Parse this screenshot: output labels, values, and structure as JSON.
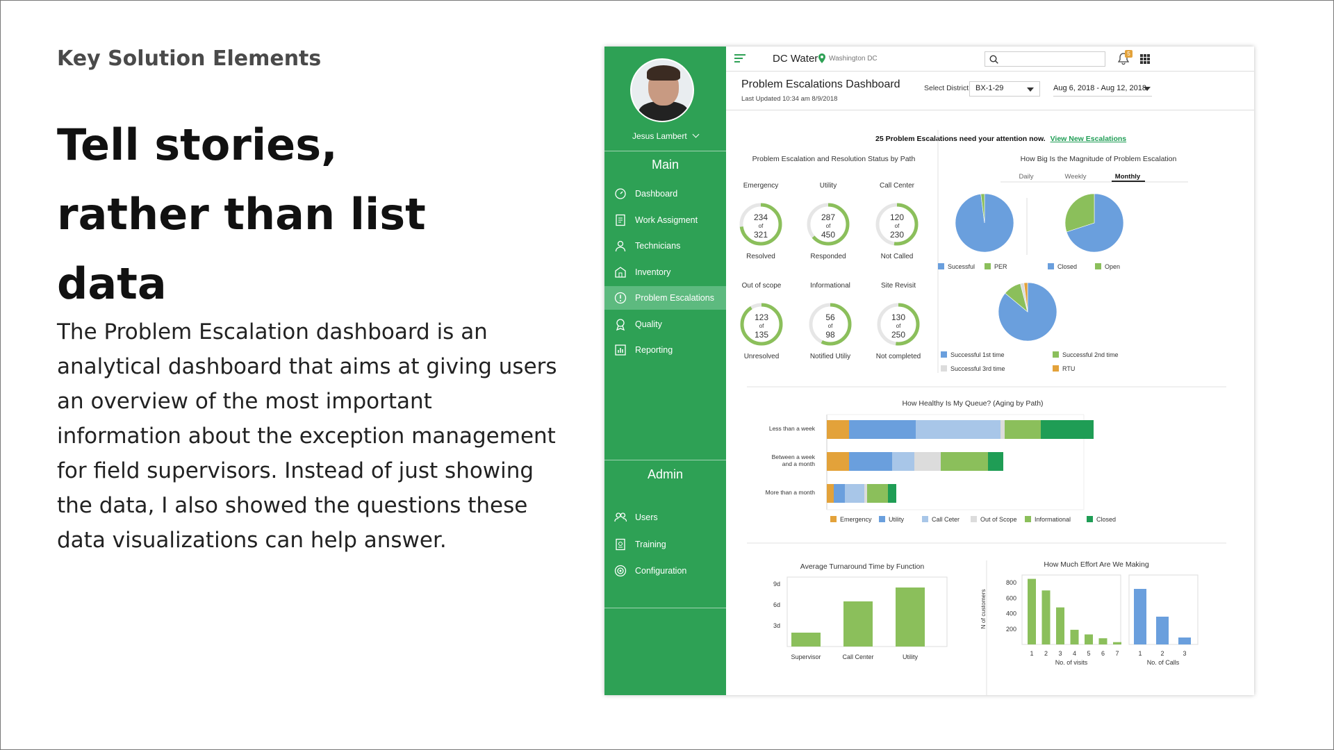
{
  "slide": {
    "kicker": "Key Solution Elements",
    "headline": "Tell stories, rather than list data",
    "body": "The Problem Escalation dashboard is an analytical dashboard that aims at giving users an overview of the most important information about the exception management for field supervisors. Instead of just showing the data, I also showed the questions these data visualizations can help answer."
  },
  "sidebar": {
    "user_name": "Jesus Lambert",
    "main_title": "Main",
    "admin_title": "Admin",
    "main_items": [
      {
        "label": "Dashboard",
        "icon": "dashboard-icon"
      },
      {
        "label": "Work Assigment",
        "icon": "document-icon"
      },
      {
        "label": "Technicians",
        "icon": "technician-icon"
      },
      {
        "label": "Inventory",
        "icon": "building-icon"
      },
      {
        "label": "Problem Escalations",
        "icon": "alert-circle-icon",
        "active": true
      },
      {
        "label": "Quality",
        "icon": "badge-icon"
      },
      {
        "label": "Reporting",
        "icon": "report-icon"
      }
    ],
    "admin_items": [
      {
        "label": "Users",
        "icon": "users-icon"
      },
      {
        "label": "Training",
        "icon": "training-icon"
      },
      {
        "label": "Configuration",
        "icon": "gear-icon"
      }
    ],
    "colors": {
      "bg": "#2ea155",
      "active": "#5dba7f"
    }
  },
  "topbar": {
    "app_name": "DC Water",
    "location": "Washington DC",
    "search_placeholder": "",
    "notification_count": "5"
  },
  "header": {
    "title": "Problem Escalations Dashboard",
    "updated": "Last Updated 10:34 am 8/9/2018",
    "district_label": "Select District",
    "district_value": "BX-1-29",
    "date_range": "Aug 6, 2018 - Aug 12, 2018"
  },
  "alert": {
    "text": "25 Problem Escalations need your attention now.",
    "link": "View New Escalations"
  },
  "status": {
    "title": "Problem Escalation and Resolution Status by Path",
    "of_word": "of",
    "rings": [
      {
        "top": "Emergency",
        "value": "234",
        "total": "321",
        "bottom": "Resolved",
        "fraction": 0.729
      },
      {
        "top": "Utility",
        "value": "287",
        "total": "450",
        "bottom": "Responded",
        "fraction": 0.638
      },
      {
        "top": "Call Center",
        "value": "120",
        "total": "230",
        "bottom": "Not Called",
        "fraction": 0.522
      },
      {
        "top": "Out of scope",
        "value": "123",
        "total": "135",
        "bottom": "Unresolved",
        "fraction": 0.911
      },
      {
        "top": "Informational",
        "value": "56",
        "total": "98",
        "bottom": "Notified Utiliy",
        "fraction": 0.571
      },
      {
        "top": "Site Revisit",
        "value": "130",
        "total": "250",
        "bottom": "Not completed",
        "fraction": 0.52
      }
    ]
  },
  "magnitude": {
    "title": "How Big Is the Magnitude of Problem Escalation",
    "tabs": [
      "Daily",
      "Weekly",
      "Monthly"
    ],
    "active_tab": "Monthly",
    "legend1": [
      "Sucessful",
      "PER"
    ],
    "legend2": [
      "Closed",
      "Open"
    ],
    "legend3": [
      "Successful 1st time",
      "Successful 2nd time",
      "Successful 3rd time",
      "RTU"
    ]
  },
  "queue": {
    "title": "How Healthy Is My Queue? (Aging by Path)",
    "legend": [
      "Emergency",
      "Utility",
      "Call Ceter",
      "Out of Scope",
      "Informational",
      "Closed"
    ]
  },
  "turnaround": {
    "title": "Average Turnaround Time by Function",
    "y_ticks": [
      "9d",
      "6d",
      "3d"
    ]
  },
  "effort": {
    "title": "How Much Effort Are We Making",
    "ylabel": "N of customers",
    "y_ticks": [
      "800",
      "600",
      "400",
      "200"
    ],
    "xlabel1": "No. of visits",
    "xlabel2": "No. of Calls"
  },
  "colors": {
    "green": "#8bbf5b",
    "blue": "#6a9fdd",
    "lightblue": "#a8c6e8",
    "orange": "#e3a23a",
    "gray": "#dcdcdc",
    "darkgreen": "#1f9d55"
  },
  "chart_data": [
    {
      "type": "pie",
      "name": "pie-success-per",
      "categories": [
        "Sucessful",
        "PER"
      ],
      "values": [
        98,
        2
      ],
      "colors": [
        "#6a9fdd",
        "#8bbf5b"
      ]
    },
    {
      "type": "pie",
      "name": "pie-closed-open",
      "categories": [
        "Closed",
        "Open"
      ],
      "values": [
        70,
        30
      ],
      "colors": [
        "#6a9fdd",
        "#8bbf5b"
      ]
    },
    {
      "type": "pie",
      "name": "pie-success-times",
      "categories": [
        "Successful 1st time",
        "Successful 2nd time",
        "Successful 3rd time",
        "RTU"
      ],
      "values": [
        86,
        10,
        2,
        2
      ],
      "colors": [
        "#6a9fdd",
        "#8bbf5b",
        "#dcdcdc",
        "#e3a23a"
      ]
    },
    {
      "type": "bar",
      "orientation": "horizontal",
      "stacked": true,
      "title": "How Healthy Is My Queue? (Aging by Path)",
      "categories": [
        "Less than a week",
        "Between a week and a month",
        "More than a month"
      ],
      "series": [
        {
          "name": "Emergency",
          "values": [
            32,
            32,
            10
          ]
        },
        {
          "name": "Utility",
          "values": [
            96,
            62,
            16
          ]
        },
        {
          "name": "Call Ceter",
          "values": [
            122,
            32,
            28
          ]
        },
        {
          "name": "Out of Scope",
          "values": [
            6,
            38,
            4
          ]
        },
        {
          "name": "Informational",
          "values": [
            52,
            68,
            30
          ]
        },
        {
          "name": "Closed",
          "values": [
            76,
            22,
            12
          ]
        }
      ]
    },
    {
      "type": "bar",
      "title": "Average Turnaround Time by Function",
      "categories": [
        "Supervisor",
        "Call Center",
        "Utility"
      ],
      "values": [
        2,
        6.5,
        8.5
      ],
      "ylim": [
        0,
        10
      ]
    },
    {
      "type": "bar",
      "title": "How Much Effort Are We Making",
      "ylabel": "N of customers",
      "xlabel": "No. of visits",
      "categories": [
        "1",
        "2",
        "3",
        "4",
        "5",
        "6",
        "7"
      ],
      "values": [
        850,
        700,
        480,
        190,
        130,
        80,
        30
      ],
      "ylim": [
        0,
        900
      ]
    },
    {
      "type": "bar",
      "xlabel": "No. of Calls",
      "categories": [
        "1",
        "2",
        "3"
      ],
      "values": [
        720,
        360,
        90
      ],
      "ylim": [
        0,
        900
      ]
    }
  ]
}
